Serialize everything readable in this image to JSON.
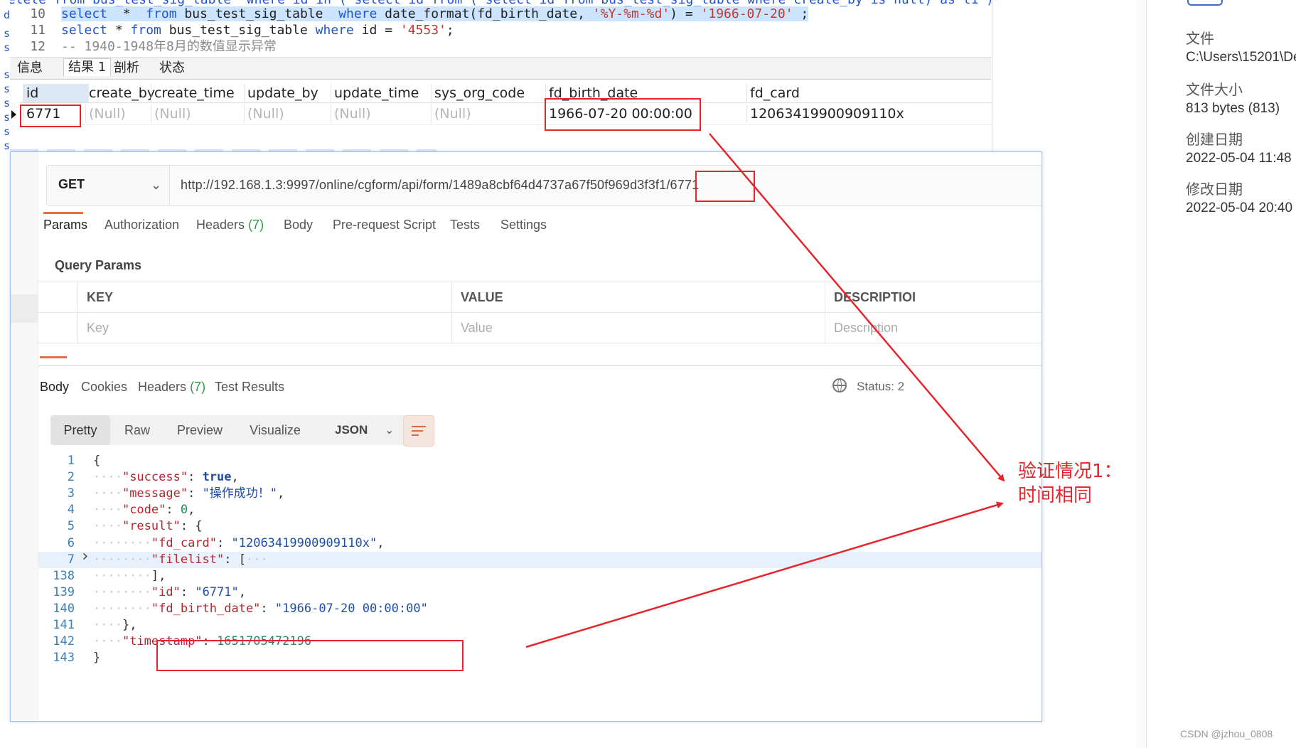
{
  "sql_editor": {
    "top_cut_line": "delete from bus_test_sig_table  where id in ( select id from ( select id from bus_test_sig_table where create_by is null) as t1 );",
    "lines": [
      {
        "num": "10",
        "segments": [
          {
            "t": "select",
            "c": "kw"
          },
          {
            "t": "  *  ",
            "c": "txt"
          },
          {
            "t": "from",
            "c": "kw"
          },
          {
            "t": " bus_test_sig_table  ",
            "c": "txt"
          },
          {
            "t": "where",
            "c": "kw"
          },
          {
            "t": " date_format(fd_birth_date, ",
            "c": "txt"
          },
          {
            "t": "'%Y-%m-%d'",
            "c": "str"
          },
          {
            "t": ") = ",
            "c": "txt"
          },
          {
            "t": "'1966-07-20'",
            "c": "str"
          },
          {
            "t": " ;",
            "c": "txt"
          }
        ]
      },
      {
        "num": "11",
        "segments": [
          {
            "t": "select",
            "c": "kw"
          },
          {
            "t": " * ",
            "c": "txt"
          },
          {
            "t": "from",
            "c": "kw"
          },
          {
            "t": " bus_test_sig_table ",
            "c": "txt"
          },
          {
            "t": "where",
            "c": "kw"
          },
          {
            "t": " id = ",
            "c": "txt"
          },
          {
            "t": "'4553'",
            "c": "str"
          },
          {
            "t": ";",
            "c": "txt"
          }
        ]
      },
      {
        "num": "12",
        "segments": [
          {
            "t": "-- 1940-1948年8月的数值显示异常",
            "c": "cm"
          }
        ]
      }
    ],
    "left_strip_letters": [
      "d",
      "s",
      "s",
      "s",
      "s",
      "s",
      "s",
      "s",
      "s"
    ],
    "result_tabs": [
      "信息",
      "结果 1",
      "剖析",
      "状态"
    ],
    "grid": {
      "columns": [
        "id",
        "create_by",
        "create_time",
        "update_by",
        "update_time",
        "sys_org_code",
        "fd_birth_date",
        "fd_card"
      ],
      "row": [
        "6771",
        "(Null)",
        "(Null)",
        "(Null)",
        "(Null)",
        "(Null)",
        "1966-07-20 00:00:00",
        "12063419900909110x"
      ]
    }
  },
  "file_panel": {
    "items": [
      {
        "label": "文件",
        "value": "C:\\Users\\15201\\De"
      },
      {
        "label": "文件大小",
        "value": "813 bytes (813)"
      },
      {
        "label": "创建日期",
        "value": "2022-05-04 11:48"
      },
      {
        "label": "修改日期",
        "value": "2022-05-04 20:40"
      }
    ]
  },
  "postman": {
    "method": "GET",
    "url": "http://192.168.1.3:9997/online/cgform/api/form/1489a8cbf64d4737a67f50f969d3f3f1/6771",
    "request_tabs": [
      {
        "label": "Params",
        "count": ""
      },
      {
        "label": "Authorization",
        "count": ""
      },
      {
        "label": "Headers",
        "count": "(7)"
      },
      {
        "label": "Body",
        "count": ""
      },
      {
        "label": "Pre-request Script",
        "count": ""
      },
      {
        "label": "Tests",
        "count": ""
      },
      {
        "label": "Settings",
        "count": ""
      }
    ],
    "query_params_title": "Query Params",
    "params_table": {
      "headers": [
        "KEY",
        "VALUE",
        "DESCRIPTIOI"
      ],
      "placeholders": [
        "Key",
        "Value",
        "Description"
      ]
    },
    "response_tabs": [
      {
        "label": "Body",
        "count": ""
      },
      {
        "label": "Cookies",
        "count": ""
      },
      {
        "label": "Headers",
        "count": "(7)"
      },
      {
        "label": "Test Results",
        "count": ""
      }
    ],
    "status_label": "Status: 2",
    "view_modes": [
      "Pretty",
      "Raw",
      "Preview",
      "Visualize"
    ],
    "format": "JSON",
    "json_lines": [
      {
        "n": "1",
        "indent": "",
        "parts": [
          {
            "t": "{",
            "c": "jp"
          }
        ]
      },
      {
        "n": "2",
        "indent": "····",
        "parts": [
          {
            "t": "\"success\"",
            "c": "jk"
          },
          {
            "t": ": ",
            "c": "jp"
          },
          {
            "t": "true",
            "c": "jb"
          },
          {
            "t": ",",
            "c": "jp"
          }
        ]
      },
      {
        "n": "3",
        "indent": "····",
        "parts": [
          {
            "t": "\"message\"",
            "c": "jk"
          },
          {
            "t": ": ",
            "c": "jp"
          },
          {
            "t": "\"操作成功！\"",
            "c": "js"
          },
          {
            "t": ",",
            "c": "jp"
          }
        ]
      },
      {
        "n": "4",
        "indent": "····",
        "parts": [
          {
            "t": "\"code\"",
            "c": "jk"
          },
          {
            "t": ": ",
            "c": "jp"
          },
          {
            "t": "0",
            "c": "jnum"
          },
          {
            "t": ",",
            "c": "jp"
          }
        ]
      },
      {
        "n": "5",
        "indent": "····",
        "parts": [
          {
            "t": "\"result\"",
            "c": "jk"
          },
          {
            "t": ": {",
            "c": "jp"
          }
        ]
      },
      {
        "n": "6",
        "indent": "········",
        "parts": [
          {
            "t": "\"fd_card\"",
            "c": "jk"
          },
          {
            "t": ": ",
            "c": "jp"
          },
          {
            "t": "\"12063419900909110x\"",
            "c": "js"
          },
          {
            "t": ",",
            "c": "jp"
          }
        ]
      },
      {
        "n": "7",
        "indent": "········",
        "parts": [
          {
            "t": "\"filelist\"",
            "c": "jk"
          },
          {
            "t": ": ",
            "c": "jp"
          },
          {
            "t": "[",
            "c": "jp"
          },
          {
            "t": "···",
            "c": "dots"
          }
        ]
      },
      {
        "n": "138",
        "indent": "········",
        "parts": [
          {
            "t": "],",
            "c": "jp"
          }
        ]
      },
      {
        "n": "139",
        "indent": "········",
        "parts": [
          {
            "t": "\"id\"",
            "c": "jk"
          },
          {
            "t": ": ",
            "c": "jp"
          },
          {
            "t": "\"6771\"",
            "c": "js"
          },
          {
            "t": ",",
            "c": "jp"
          }
        ]
      },
      {
        "n": "140",
        "indent": "········",
        "parts": [
          {
            "t": "\"fd_birth_date\"",
            "c": "jk"
          },
          {
            "t": ": ",
            "c": "jp"
          },
          {
            "t": "\"1966-07-20 00:00:00\"",
            "c": "js"
          }
        ]
      },
      {
        "n": "141",
        "indent": "····",
        "parts": [
          {
            "t": "},",
            "c": "jp"
          }
        ]
      },
      {
        "n": "142",
        "indent": "····",
        "parts": [
          {
            "t": "\"timestamp\"",
            "c": "jk"
          },
          {
            "t": ": ",
            "c": "jp"
          },
          {
            "t": "1651705472196",
            "c": "jnum"
          }
        ]
      },
      {
        "n": "143",
        "indent": "",
        "parts": [
          {
            "t": "}",
            "c": "jp"
          }
        ]
      }
    ]
  },
  "annotation": {
    "text": "验证情况1：\n时间相同",
    "color": "#e5252c"
  },
  "watermark": "CSDN @jzhou_0808"
}
